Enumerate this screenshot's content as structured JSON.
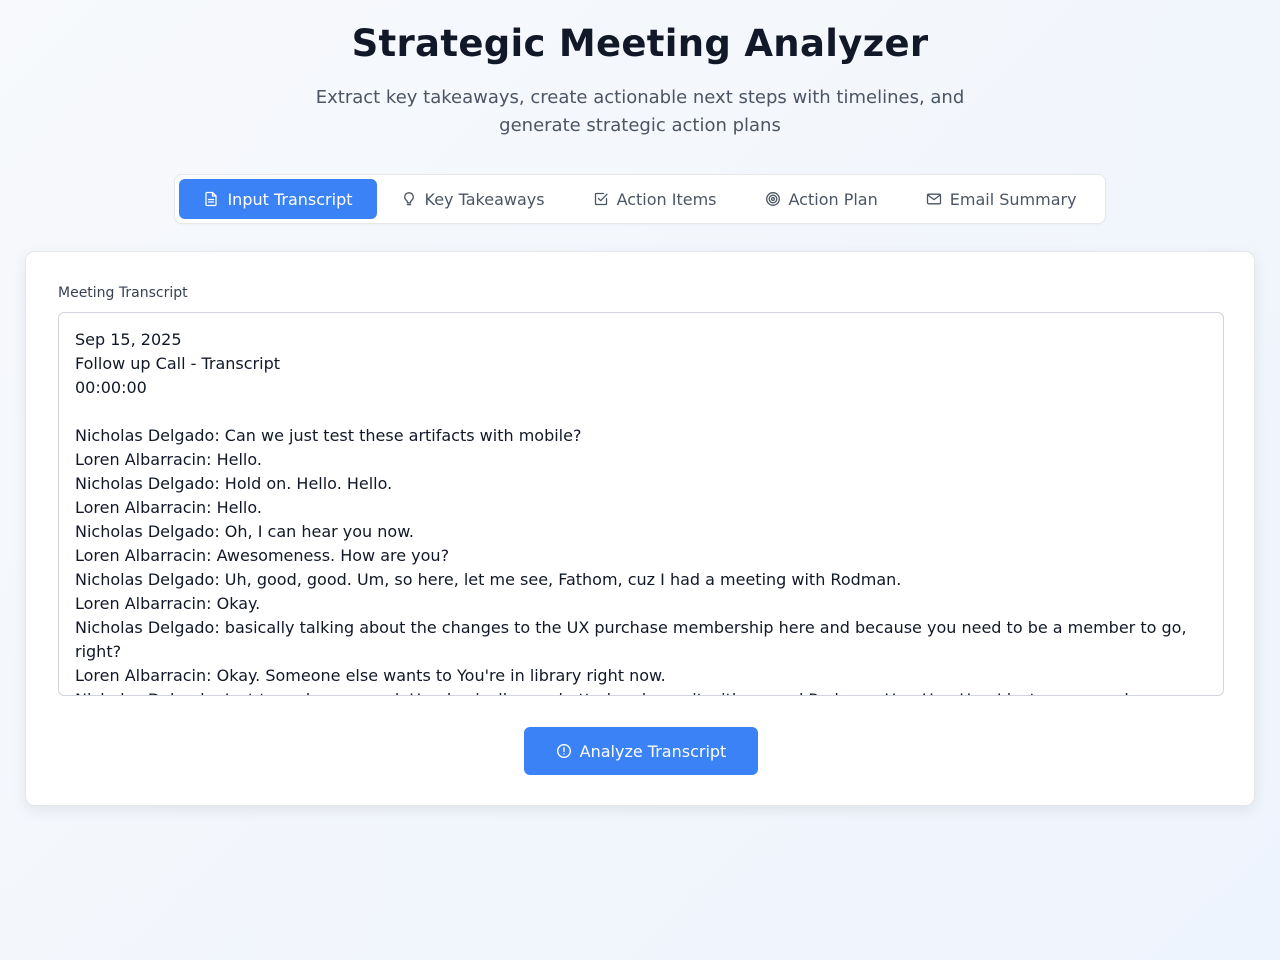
{
  "header": {
    "title": "Strategic Meeting Analyzer",
    "subtitle": "Extract key takeaways, create actionable next steps with timelines, and generate strategic action plans"
  },
  "tabs": [
    {
      "label": "Input Transcript",
      "icon": "document-icon",
      "active": true
    },
    {
      "label": "Key Takeaways",
      "icon": "lightbulb-icon",
      "active": false
    },
    {
      "label": "Action Items",
      "icon": "checkbox-icon",
      "active": false
    },
    {
      "label": "Action Plan",
      "icon": "target-icon",
      "active": false
    },
    {
      "label": "Email Summary",
      "icon": "mail-icon",
      "active": false
    }
  ],
  "form": {
    "label": "Meeting Transcript",
    "transcript_lines": [
      "Sep 15, 2025",
      "Follow up Call - Transcript",
      "00:00:00",
      "",
      "Nicholas Delgado: Can we just test these artifacts with mobile?",
      "Loren Albarracin: Hello.",
      "Nicholas Delgado: Hold on. Hello. Hello.",
      "Loren Albarracin: Hello.",
      "Nicholas Delgado: Oh, I can hear you now.",
      "Loren Albarracin: Awesomeness. How are you?",
      "Nicholas Delgado: Uh, good, good. Um, so here, let me see, Fathom, cuz I had a meeting with Rodman.",
      "Loren Albarracin: Okay.",
      "Nicholas Delgado: basically talking about the changes to the UX purchase membership here and because you need to be a member to go, right?",
      "Loren Albarracin: Okay. Someone else wants to You're in library right now.",
      "Nicholas Delgado: Just to make sure and. Um, basically we chatted and, um, it with around Rodman. Um, Um, Um, I just wanna make sure. So, so then what. Um the"
    ],
    "submit_label": "Analyze Transcript"
  },
  "colors": {
    "accent": "#3b82f6",
    "background": "#f3f7fd"
  }
}
